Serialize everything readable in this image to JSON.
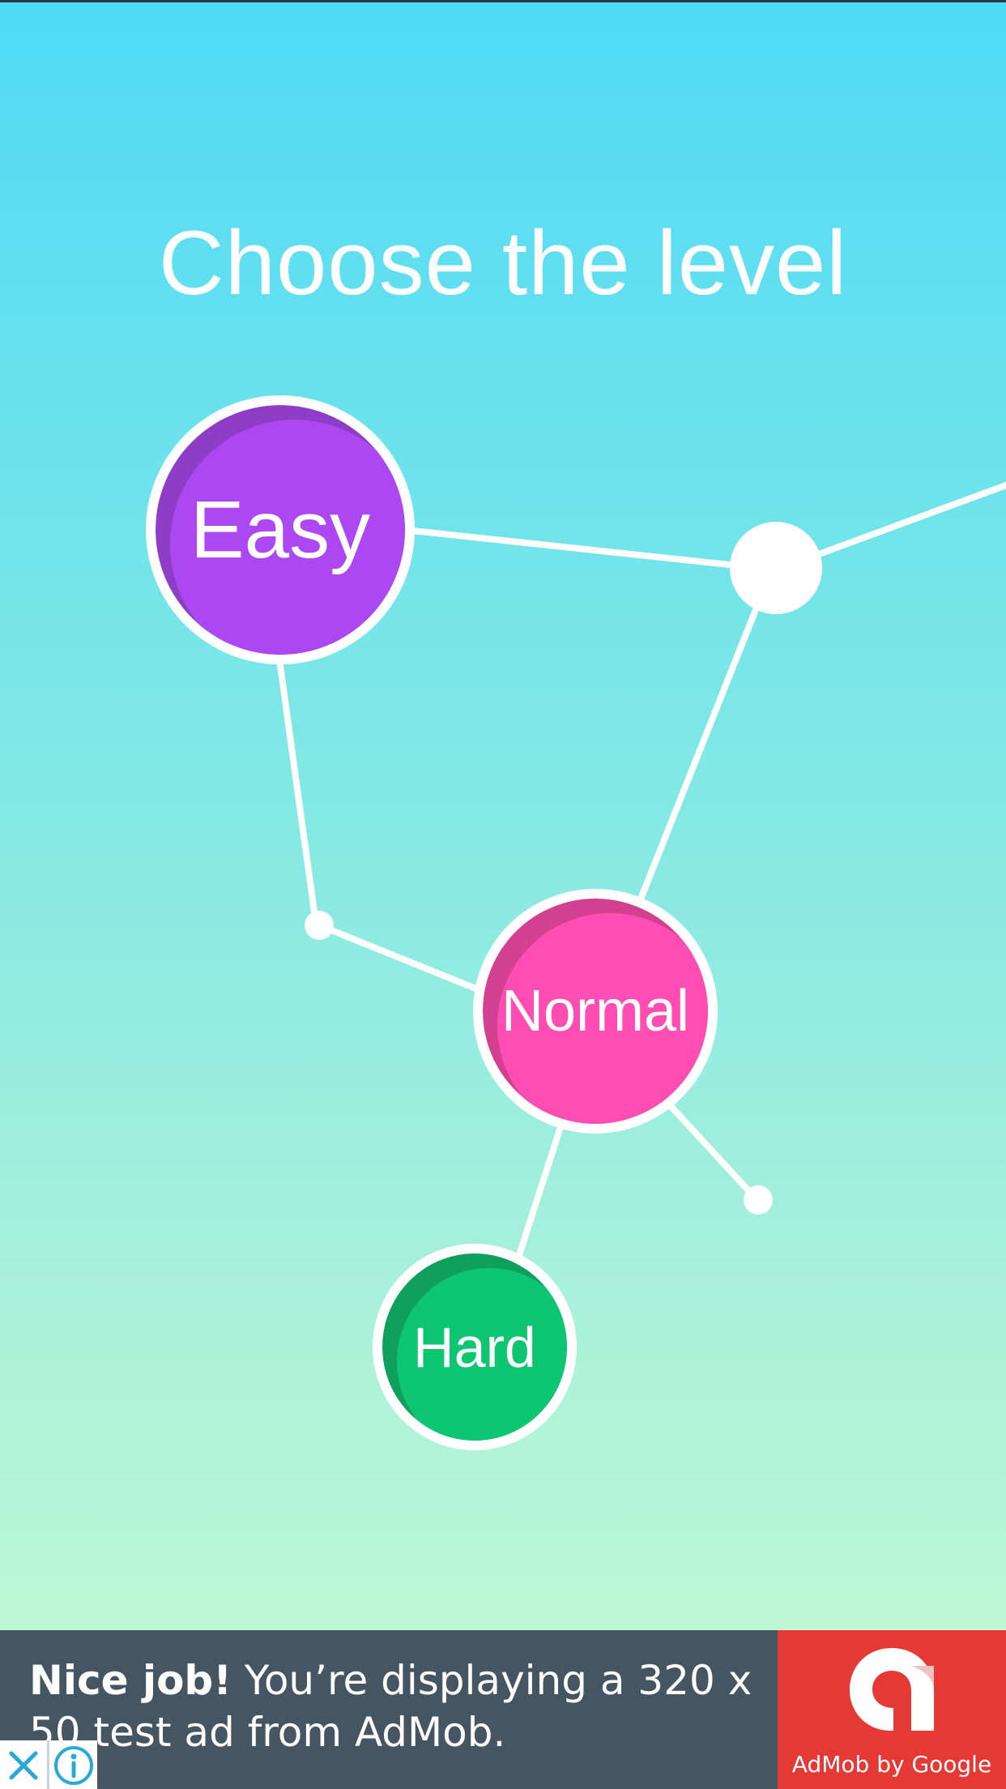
{
  "screen": {
    "title": "Choose the level"
  },
  "levels": [
    {
      "id": "easy",
      "label": "Easy",
      "color": "#ac48f2",
      "shade": "#8e3ec6"
    },
    {
      "id": "normal",
      "label": "Normal",
      "color": "#ff4db3",
      "shade": "#d1418f"
    },
    {
      "id": "hard",
      "label": "Hard",
      "color": "#0ec671",
      "shade": "#0ea05c"
    }
  ],
  "ad": {
    "headline": "Nice job!",
    "body": " You’re displaying a 320 x 50 test ad from AdMob.",
    "brand": "AdMob by Google",
    "close_icon": "close-icon",
    "info_icon": "info-icon",
    "background": "#455562",
    "brand_color": "#e53935"
  },
  "colors": {
    "background_top": "#4fdaf6",
    "background_bottom": "#c6fbd2",
    "line": "#ffffff"
  }
}
